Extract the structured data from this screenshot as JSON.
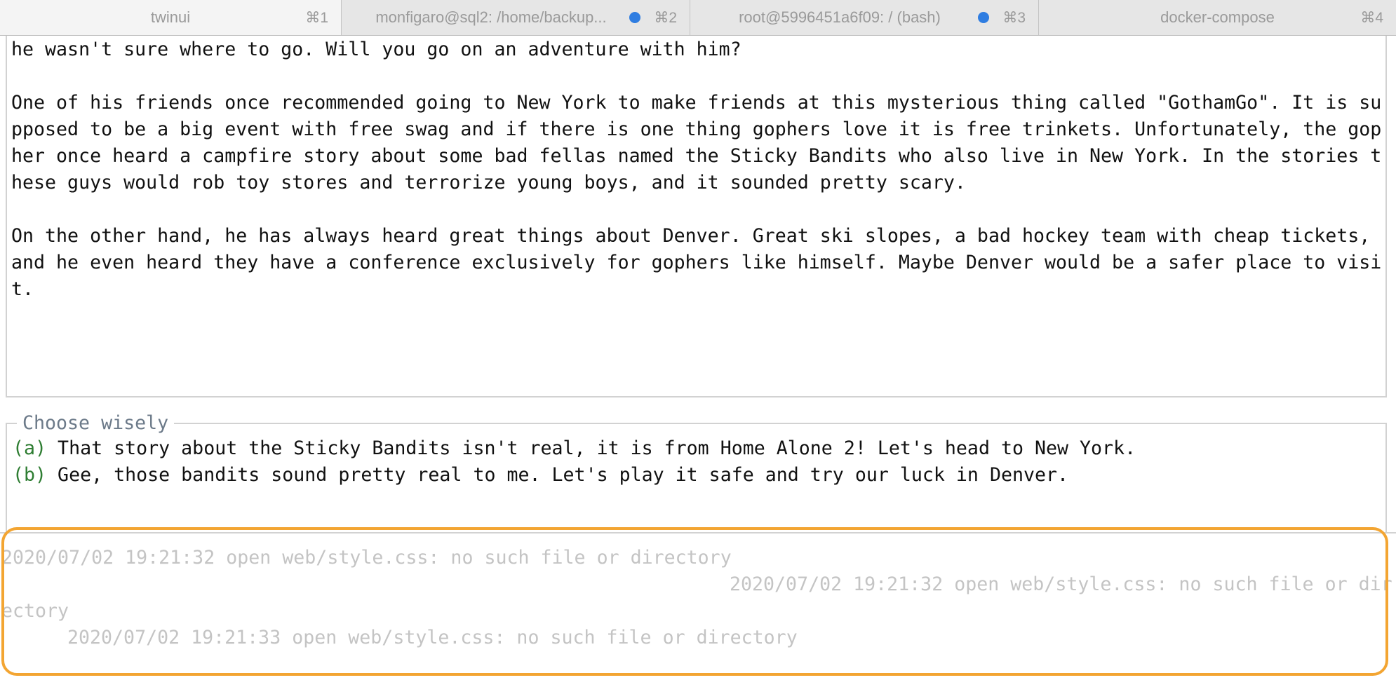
{
  "tabs": [
    {
      "title": "twinui",
      "shortcut": "⌘1",
      "active": true,
      "badge": false
    },
    {
      "title": "monfigaro@sql2: /home/backup...",
      "shortcut": "⌘2",
      "active": false,
      "badge": true
    },
    {
      "title": "root@5996451a6f09: / (bash)",
      "shortcut": "⌘3",
      "active": false,
      "badge": true
    },
    {
      "title": "docker-compose",
      "shortcut": "⌘4",
      "active": false,
      "badge": false
    }
  ],
  "colors": {
    "tab_badge": "#2f7de1",
    "choice_key": "#2e7d32",
    "highlight": "#f3a532",
    "log_text": "#c4c4c4"
  },
  "story": {
    "lines": [
      "he wasn't sure where to go. Will you go on an adventure with him?",
      "",
      "One of his friends once recommended going to New York to make friends at this mysterious thing called \"GothamGo\". It is su",
      "pposed to be a big event with free swag and if there is one thing gophers love it is free trinkets. Unfortunately, the gop",
      "her once heard a campfire story about some bad fellas named the Sticky Bandits who also live in New York. In the stories t",
      "hese guys would rob toy stores and terrorize young boys, and it sounded pretty scary.",
      "",
      "On the other hand, he has always heard great things about Denver. Great ski slopes, a bad hockey team with cheap tickets,",
      "and he even heard they have a conference exclusively for gophers like himself. Maybe Denver would be a safer place to visi",
      "t."
    ]
  },
  "choices": {
    "title": "Choose wisely",
    "items": [
      {
        "key": "(a)",
        "text": " That story about the Sticky Bandits isn't real, it is from Home Alone 2! Let's head to New York."
      },
      {
        "key": "(b)",
        "text": " Gee, those bandits sound pretty real to me. Let's play it safe and try our luck in Denver."
      }
    ]
  },
  "log": {
    "lines": [
      "2020/07/02 19:21:32 open web/style.css: no such file or directory",
      "2020/07/02 19:21:32 open web/style.css: no such file or dir",
      "ectory",
      "2020/07/02 19:21:33 open web/style.css: no such file or directory"
    ]
  }
}
